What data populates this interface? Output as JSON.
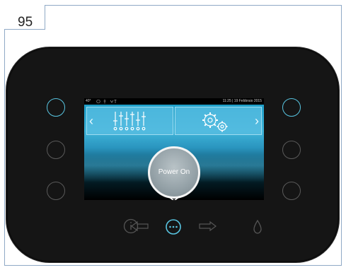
{
  "figure_label": "95",
  "status_bar": {
    "left_text": "40°",
    "right_text": "11:25 | 19 Febbraio 2015"
  },
  "screen": {
    "power_button_label": "Power On"
  },
  "colors": {
    "accent": "#58c4e0",
    "device_body": "#151515",
    "inactive_ring": "#5a5a5a",
    "frame_border": "#8fa9c6"
  },
  "icons": {
    "left_tile": "sliders-icon",
    "right_tile": "gears-icon",
    "bottom_bar": [
      "info-icon",
      "arrow-left-icon",
      "more-icon",
      "arrow-right-icon",
      "drop-icon"
    ]
  }
}
